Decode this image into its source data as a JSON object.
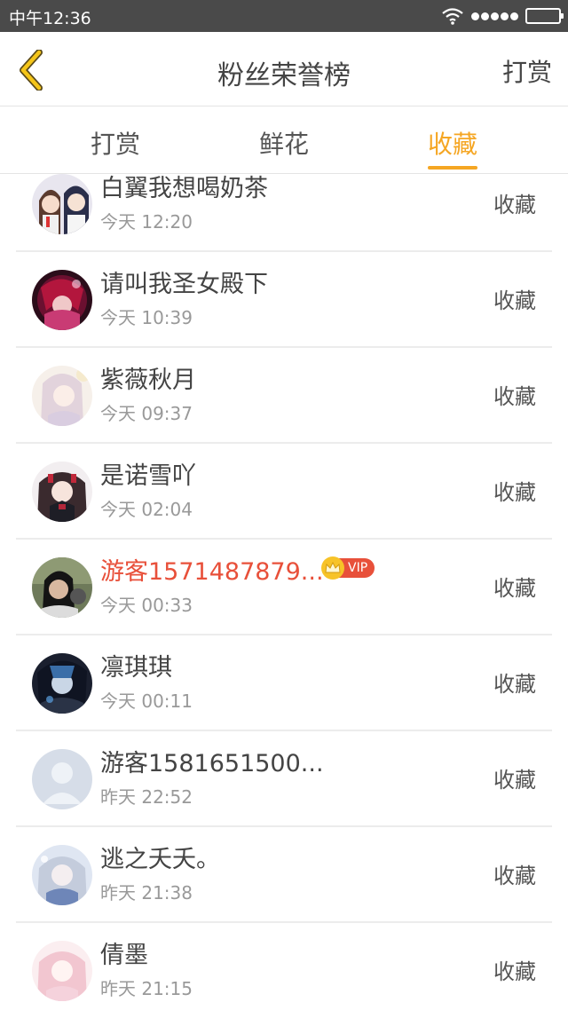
{
  "status_bar": {
    "time": "中午12:36"
  },
  "header": {
    "title": "粉丝荣誉榜",
    "right_action": "打赏"
  },
  "tabs": [
    {
      "label": "打赏",
      "active": false
    },
    {
      "label": "鲜花",
      "active": false
    },
    {
      "label": "收藏",
      "active": true
    }
  ],
  "accent_color": "#f5a623",
  "list": [
    {
      "name": "白翼我想喝奶茶",
      "time": "今天 12:20",
      "action": "收藏",
      "avatar": "anime-boys-avatar"
    },
    {
      "name": "请叫我圣女殿下",
      "time": "今天 10:39",
      "action": "收藏",
      "avatar": "anime-girl-red-avatar"
    },
    {
      "name": "紫薇秋月",
      "time": "今天 09:37",
      "action": "收藏",
      "avatar": "anime-girl-pale-avatar"
    },
    {
      "name": "是诺雪吖",
      "time": "今天 02:04",
      "action": "收藏",
      "avatar": "anime-girl-gothic-avatar"
    },
    {
      "name": "游客1571487879...",
      "time": "今天 00:33",
      "action": "收藏",
      "avatar": "photo-avatar",
      "highlight": true,
      "badge": "VIP"
    },
    {
      "name": "凛琪琪",
      "time": "今天 00:11",
      "action": "收藏",
      "avatar": "anime-blue-avatar"
    },
    {
      "name": "游客1581651500...",
      "time": "昨天 22:52",
      "action": "收藏",
      "avatar": "default-user-avatar"
    },
    {
      "name": "逃之夭夭。",
      "time": "昨天 21:38",
      "action": "收藏",
      "avatar": "anime-girl-silver-avatar"
    },
    {
      "name": "倩墨",
      "time": "昨天 21:15",
      "action": "收藏",
      "avatar": "anime-girl-pink-avatar"
    }
  ]
}
